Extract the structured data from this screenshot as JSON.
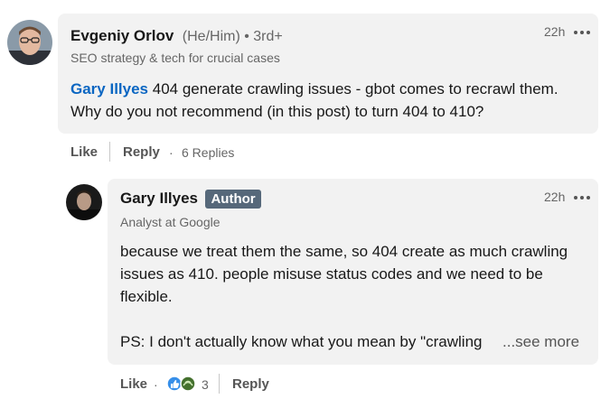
{
  "comment": {
    "author_name": "Evgeniy Orlov",
    "pronouns": "(He/Him)",
    "connection": "• 3rd+",
    "headline": "SEO strategy & tech for crucial cases",
    "time": "22h",
    "mention": "Gary Illyes",
    "body_line1": " 404 generate crawling issues - gbot comes to recrawl them.",
    "body_line2": "Why do you not recommend (in this post) to turn 404 to 410?",
    "actions": {
      "like": "Like",
      "reply": "Reply",
      "dot": "·",
      "replies_count": "6 Replies"
    }
  },
  "reply": {
    "author_name": "Gary Illyes",
    "badge": "Author",
    "headline": "Analyst at Google",
    "time": "22h",
    "body_line1": "because we treat them the same, so 404 create as much crawling",
    "body_line2": "issues as 410. people misuse status codes and we need to be",
    "body_line3": "flexible.",
    "body_line4": "PS: I don't actually know what you mean by \"crawling",
    "see_more": "...see more",
    "actions": {
      "like": "Like",
      "dot": "·",
      "reaction_count": "3",
      "reply": "Reply"
    }
  },
  "icons": {
    "more": "more-icon",
    "like_reaction": "like-reaction-icon",
    "support_reaction": "support-reaction-icon"
  },
  "colors": {
    "mention": "#0a66c2",
    "bubble": "#f2f2f2",
    "badge": "#56687a"
  }
}
